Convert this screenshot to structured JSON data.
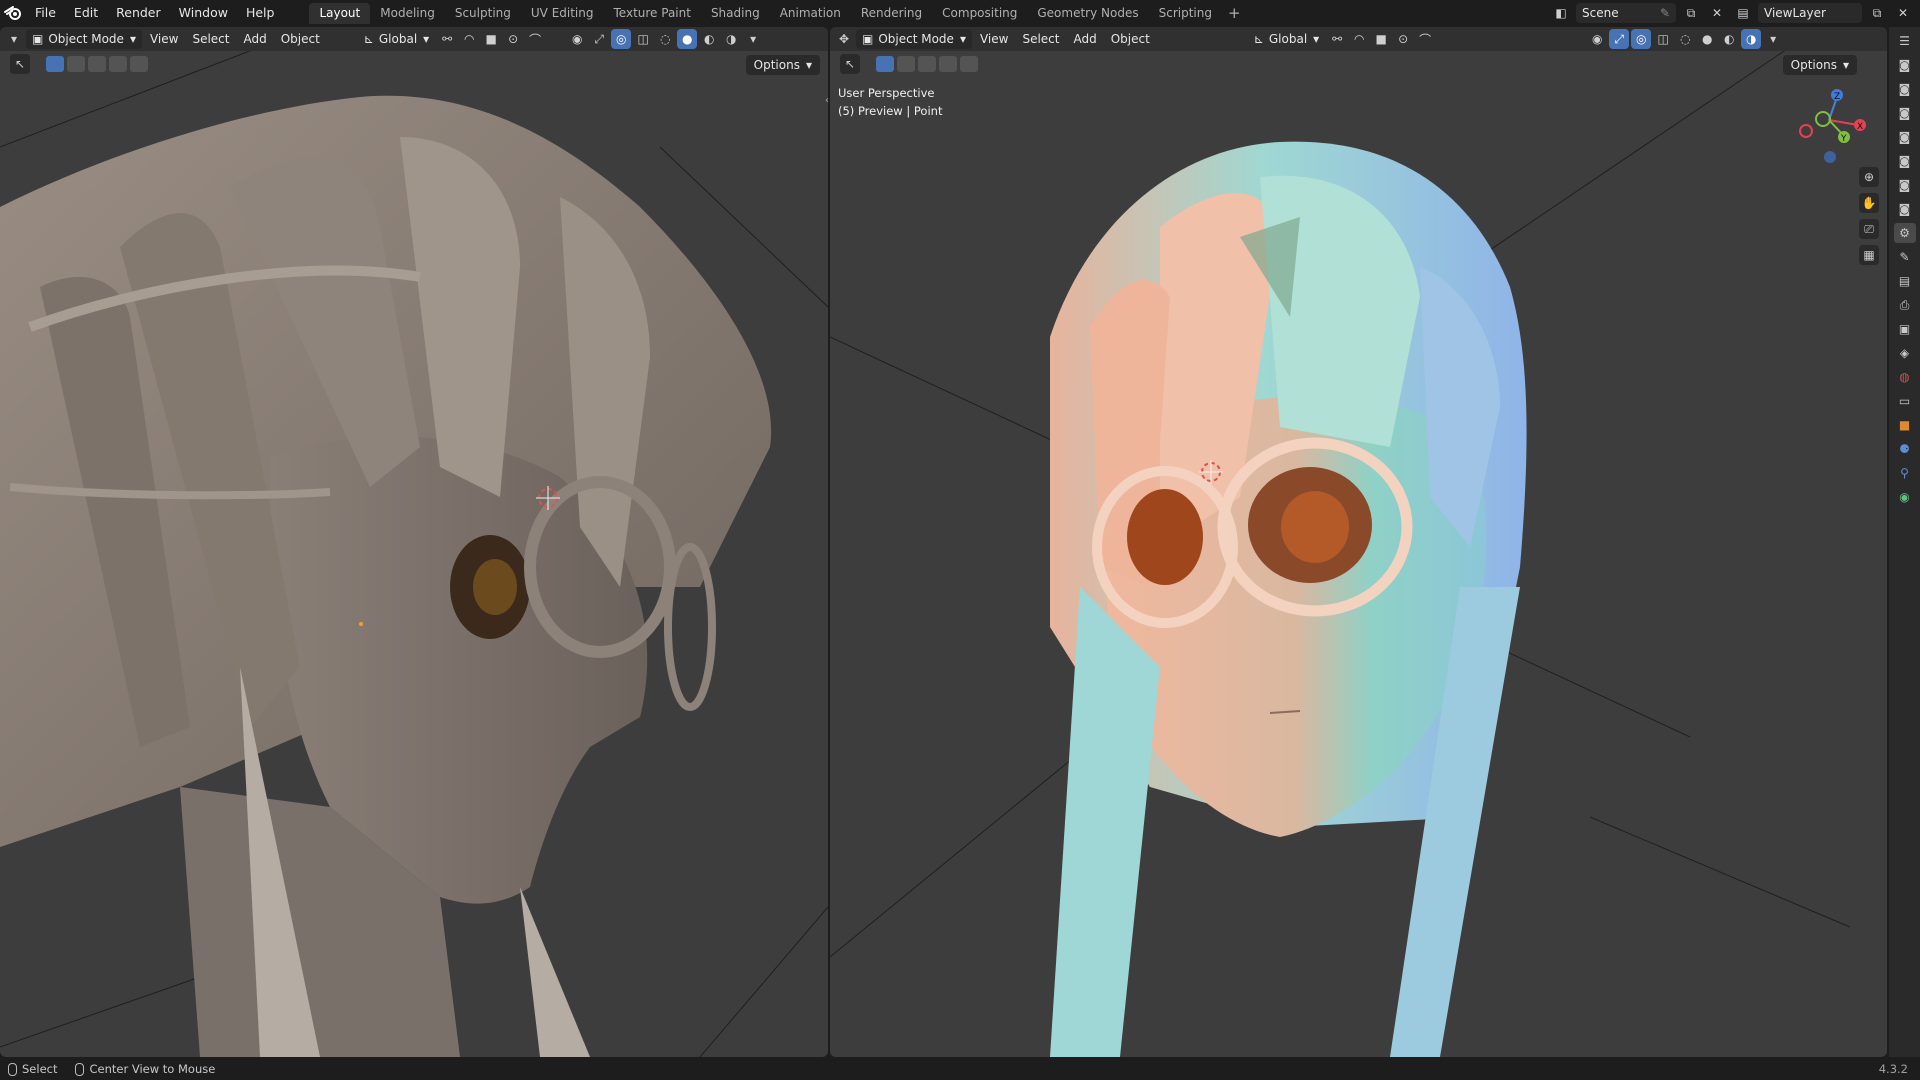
{
  "topbar": {
    "menus": [
      "File",
      "Edit",
      "Render",
      "Window",
      "Help"
    ],
    "workspaces": [
      "Layout",
      "Modeling",
      "Sculpting",
      "UV Editing",
      "Texture Paint",
      "Shading",
      "Animation",
      "Rendering",
      "Compositing",
      "Geometry Nodes",
      "Scripting"
    ],
    "active_workspace": "Layout",
    "scene": "Scene",
    "view_layer": "ViewLayer"
  },
  "left_viewport": {
    "mode": "Object Mode",
    "menus": [
      "View",
      "Select",
      "Add",
      "Object"
    ],
    "orientation": "Global",
    "options": "Options"
  },
  "right_viewport": {
    "mode": "Object Mode",
    "menus": [
      "View",
      "Select",
      "Add",
      "Object"
    ],
    "orientation": "Global",
    "options": "Options",
    "perspective": "User Perspective",
    "info": "(5) Preview | Point",
    "gizmo": {
      "z": "Z",
      "y": "Y",
      "x": "X"
    }
  },
  "statusbar": {
    "select": "Select",
    "center": "Center View to Mouse",
    "version": "4.3.2"
  },
  "colors": {
    "accent": "#4772b3",
    "viewport_bg": "#3d3d3d",
    "ui_bg": "#1d1d1d"
  }
}
